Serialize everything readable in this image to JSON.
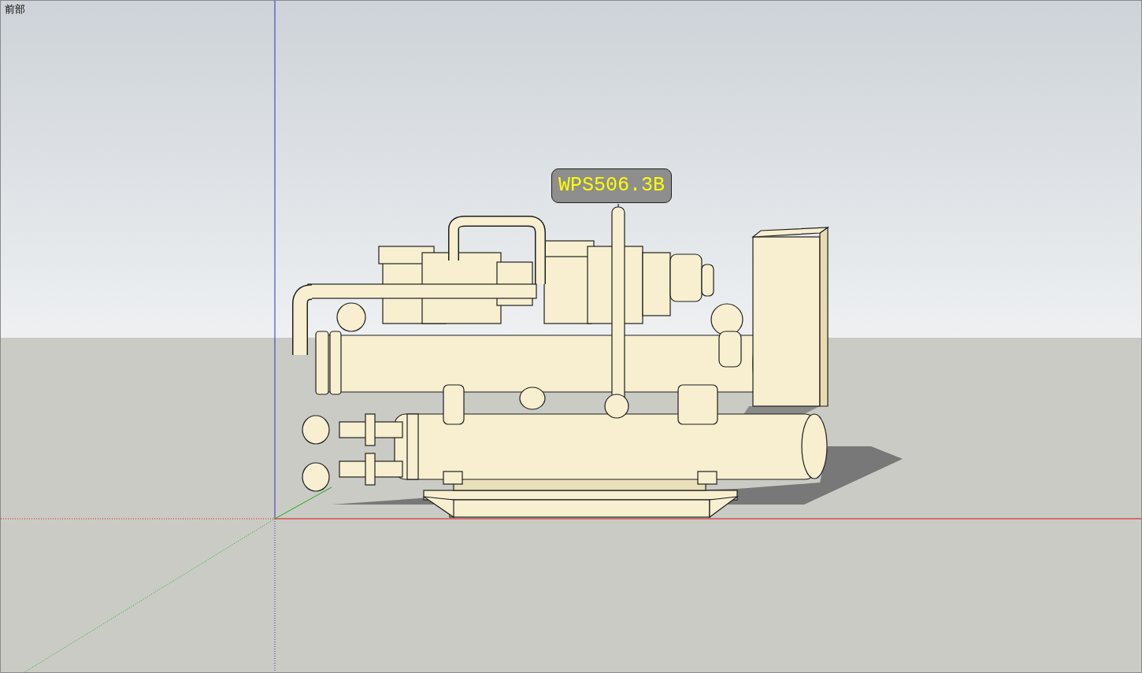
{
  "view": {
    "name": "前部"
  },
  "model": {
    "label": "WPS506.3B"
  }
}
